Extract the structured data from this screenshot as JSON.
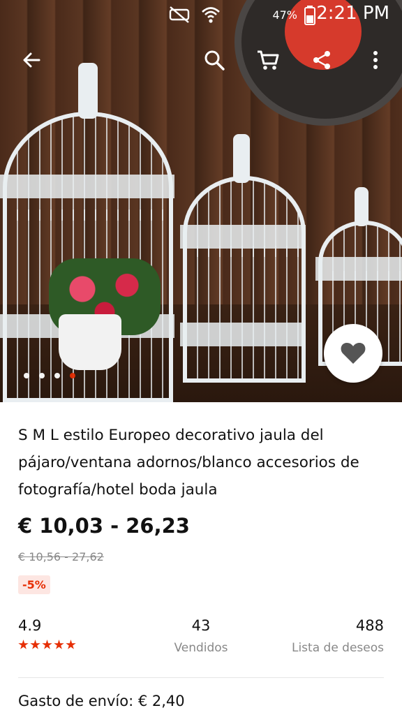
{
  "status_bar": {
    "battery": "47%",
    "time": "2:21 PM",
    "icons": [
      "mute-icon",
      "wifi-icon",
      "battery-icon"
    ]
  },
  "nav": {
    "icons": [
      "back-arrow-icon",
      "search-icon",
      "cart-icon",
      "share-icon",
      "more-vert-icon"
    ]
  },
  "gallery": {
    "total": 4,
    "active": 4
  },
  "product": {
    "title": "S M L estilo Europeo decorativo jaula del pájaro/ventana adornos/blanco accesorios de fotografía/hotel boda jaula",
    "price": "€ 10,03 - 26,23",
    "original_price": "€ 10,56 - 27,62",
    "discount": "-5%"
  },
  "stats": {
    "rating": "4.9",
    "stars": 5,
    "sold_count": "43",
    "sold_label": "Vendidos",
    "wishlist_count": "488",
    "wishlist_label": "Lista de deseos"
  },
  "shipping": {
    "label": "Gasto de envío: € 2,40"
  },
  "colors": {
    "accent": "#e62e04",
    "discount_bg": "#fde6e2",
    "muted_text": "#888888"
  }
}
